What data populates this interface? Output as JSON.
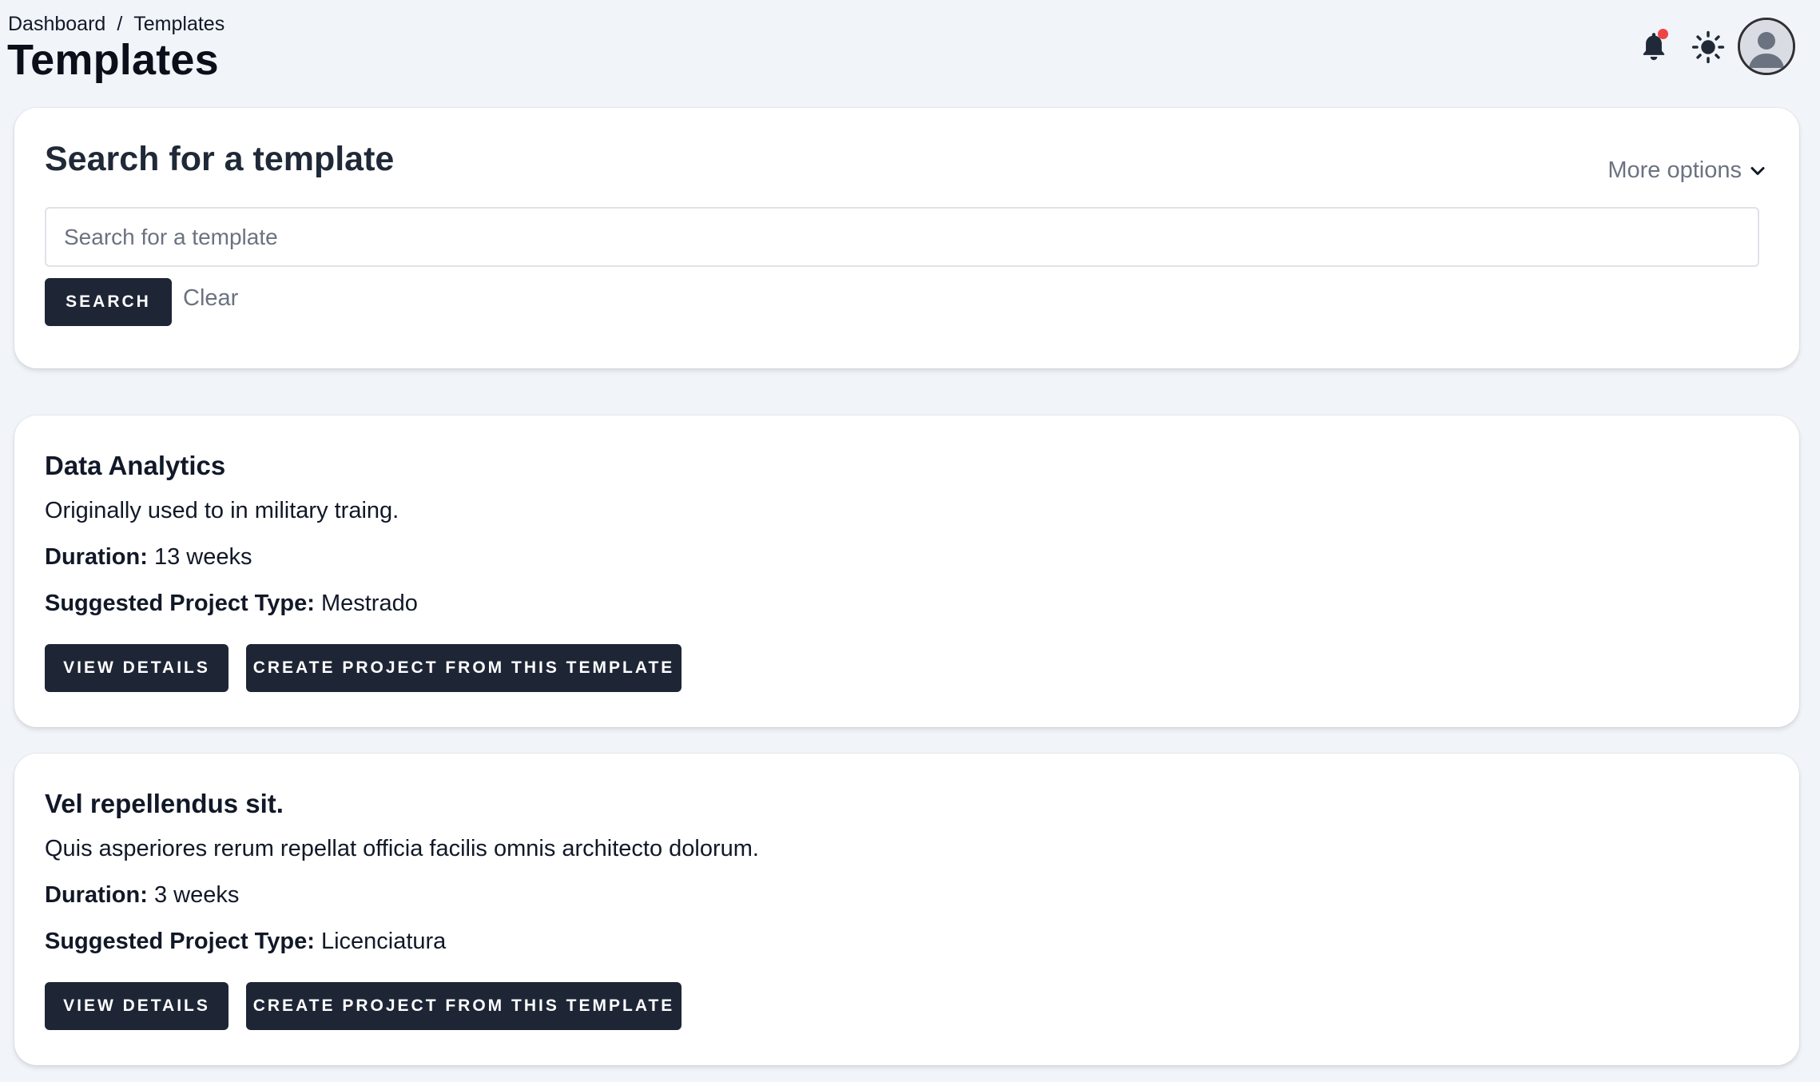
{
  "breadcrumb": {
    "items": [
      "Dashboard",
      "Templates"
    ],
    "separator": "/"
  },
  "page": {
    "title": "Templates"
  },
  "header": {
    "icons": {
      "notifications": "bell-icon",
      "theme": "sun-icon",
      "avatar": "user-avatar-icon"
    },
    "notification_dot_color": "#ef4444"
  },
  "search": {
    "title": "Search for a template",
    "more_options_label": "More options",
    "placeholder": "Search for a template",
    "value": "",
    "search_label": "SEARCH",
    "clear_label": "Clear"
  },
  "templates": [
    {
      "name": "Data Analytics",
      "description": "Originally used to in military traing.",
      "duration_label": "Duration:",
      "duration": "13 weeks",
      "type_label": "Suggested Project Type:",
      "type": "Mestrado",
      "view_label": "VIEW DETAILS",
      "create_label": "CREATE PROJECT FROM THIS TEMPLATE"
    },
    {
      "name": "Vel repellendus sit.",
      "description": "Quis asperiores rerum repellat officia facilis omnis architecto dolorum.",
      "duration_label": "Duration:",
      "duration": "3 weeks",
      "type_label": "Suggested Project Type:",
      "type": "Licenciatura",
      "view_label": "VIEW DETAILS",
      "create_label": "CREATE PROJECT FROM THIS TEMPLATE"
    }
  ],
  "colors": {
    "button_dark": "#1e2636",
    "page_bg": "#f1f4f8",
    "muted_text": "#6b7280"
  }
}
